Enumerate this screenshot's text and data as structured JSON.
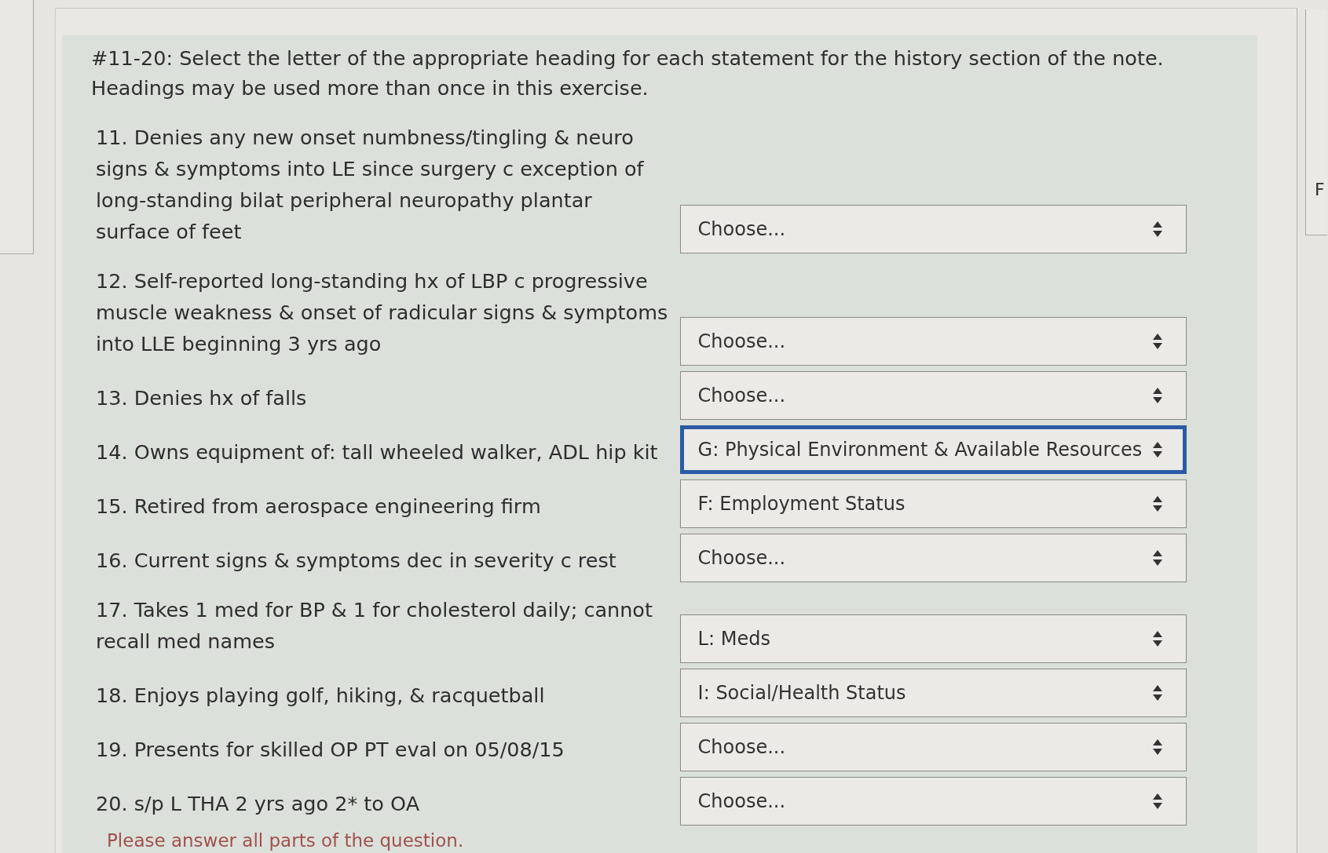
{
  "question": {
    "instructions": "#11-20: Select the letter of the appropriate heading for each statement for the history section of the note. Headings may be used more than once in this exercise.",
    "items": [
      {
        "statement": "11. Denies any new onset numbness/tingling & neuro signs & symptoms into LE since surgery c exception of long-standing bilat peripheral neuropathy plantar surface of feet",
        "answer": "Choose...",
        "focused": false
      },
      {
        "statement": "12. Self-reported long-standing hx of LBP c progressive muscle weakness & onset of radicular signs & symptoms into LLE beginning 3 yrs ago",
        "answer": "Choose...",
        "focused": false
      },
      {
        "statement": "13. Denies hx of falls",
        "answer": "Choose...",
        "focused": false
      },
      {
        "statement": "14. Owns equipment of: tall wheeled walker, ADL hip kit",
        "answer": "G: Physical Environment & Available Resources",
        "focused": true
      },
      {
        "statement": "15. Retired from aerospace engineering firm",
        "answer": "F: Employment Status",
        "focused": false
      },
      {
        "statement": "16. Current signs & symptoms dec in severity c rest",
        "answer": "Choose...",
        "focused": false
      },
      {
        "statement": "17. Takes 1 med for BP & 1 for cholesterol daily; cannot recall med names",
        "answer": "L: Meds",
        "focused": false
      },
      {
        "statement": "18. Enjoys playing golf, hiking, & racquetball",
        "answer": "I: Social/Health Status",
        "focused": false
      },
      {
        "statement": "19. Presents for skilled OP PT eval on 05/08/15",
        "answer": "Choose...",
        "focused": false
      },
      {
        "statement": "20. s/p L THA 2 yrs ago 2* to OA",
        "answer": "Choose...",
        "focused": false
      }
    ],
    "validation_message": "Please answer all parts of the question."
  },
  "side_panel": {
    "text": "F"
  }
}
